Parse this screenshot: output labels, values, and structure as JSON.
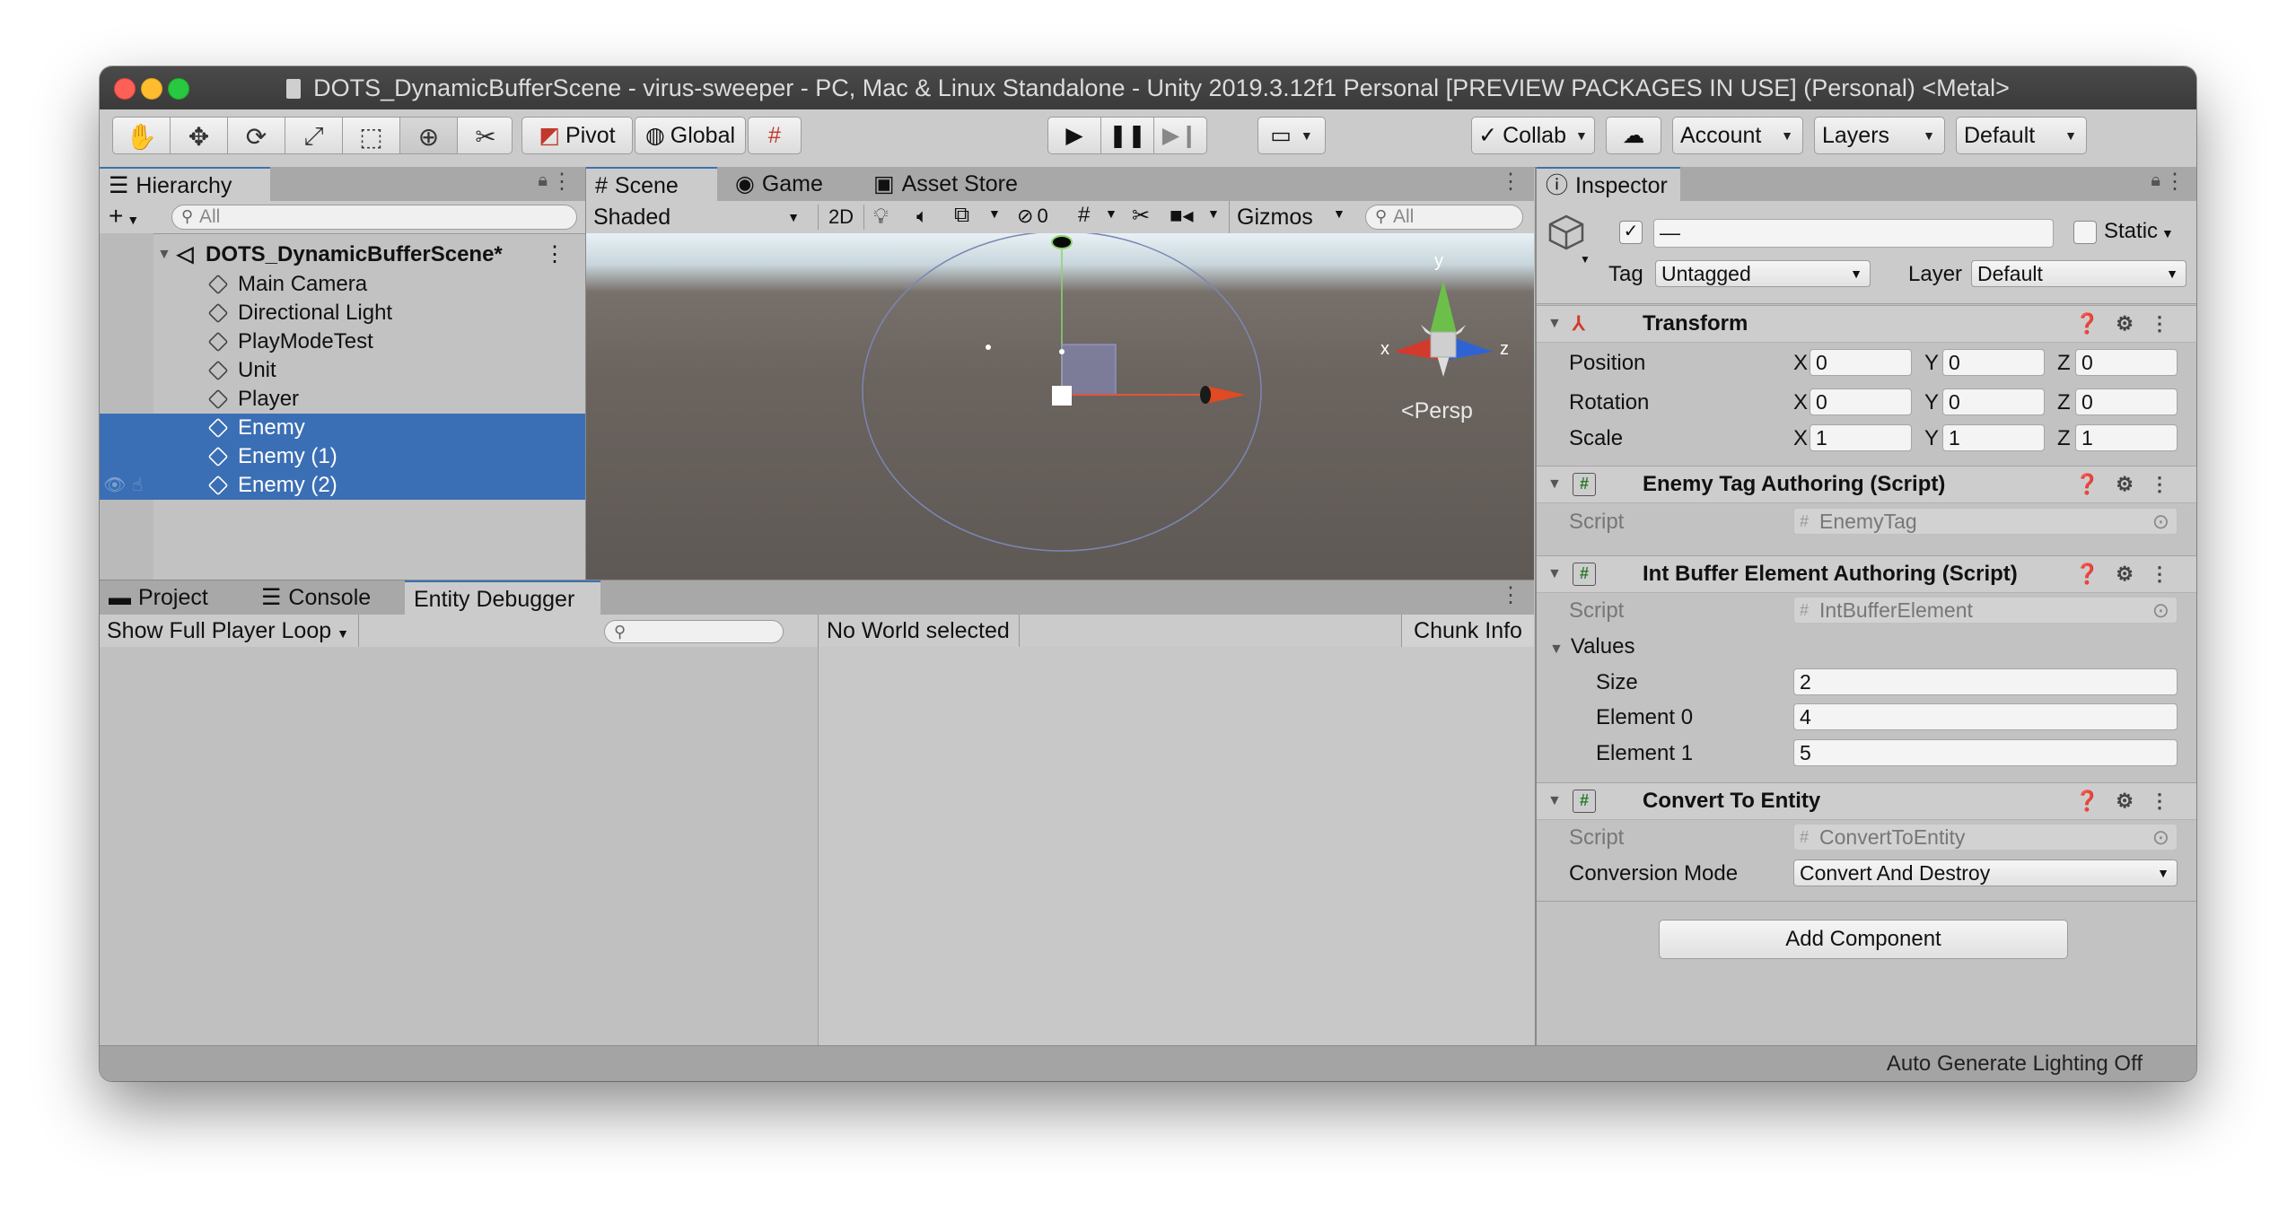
{
  "window": {
    "title": "DOTS_DynamicBufferScene - virus-sweeper - PC, Mac & Linux Standalone - Unity 2019.3.12f1 Personal [PREVIEW PACKAGES IN USE] (Personal) <Metal>"
  },
  "toolbar": {
    "pivot": "Pivot",
    "global": "Global",
    "collab": "Collab",
    "account": "Account",
    "layers": "Layers",
    "layout": "Default"
  },
  "hierarchy": {
    "tab": "Hierarchy",
    "search_placeholder": "All",
    "scene": "DOTS_DynamicBufferScene*",
    "items": [
      {
        "label": "Main Camera"
      },
      {
        "label": "Directional Light"
      },
      {
        "label": "PlayModeTest"
      },
      {
        "label": "Unit"
      },
      {
        "label": "Player"
      },
      {
        "label": "Enemy"
      },
      {
        "label": "Enemy (1)"
      },
      {
        "label": "Enemy (2)"
      }
    ]
  },
  "scene_view": {
    "tabs": [
      "Scene",
      "Game",
      "Asset Store"
    ],
    "shading": "Shaded",
    "mode_2d": "2D",
    "hidden_count": "0",
    "gizmos": "Gizmos",
    "search_placeholder": "All",
    "projection": "Persp",
    "axis_x": "x",
    "axis_y": "y",
    "axis_z": "z"
  },
  "bottom": {
    "tabs": [
      "Project",
      "Console",
      "Entity Debugger"
    ],
    "player_loop": "Show Full Player Loop",
    "world": "No World selected",
    "chunk_info": "Chunk Info"
  },
  "inspector": {
    "tab": "Inspector",
    "name_value": "—",
    "static": "Static",
    "tag_label": "Tag",
    "tag_value": "Untagged",
    "layer_label": "Layer",
    "layer_value": "Default",
    "transform": {
      "title": "Transform",
      "rows": [
        {
          "label": "Position",
          "x": "0",
          "y": "0",
          "z": "0"
        },
        {
          "label": "Rotation",
          "x": "0",
          "y": "0",
          "z": "0"
        },
        {
          "label": "Scale",
          "x": "1",
          "y": "1",
          "z": "1"
        }
      ],
      "x": "X",
      "y": "Y",
      "z": "Z"
    },
    "enemy_tag": {
      "title": "Enemy Tag Authoring (Script)",
      "script_label": "Script",
      "script_value": "EnemyTag"
    },
    "int_buffer": {
      "title": "Int Buffer Element Authoring (Script)",
      "script_label": "Script",
      "script_value": "IntBufferElement",
      "values_label": "Values",
      "size_label": "Size",
      "size_value": "2",
      "element0_label": "Element 0",
      "element0_value": "4",
      "element1_label": "Element 1",
      "element1_value": "5"
    },
    "convert": {
      "title": "Convert To Entity",
      "script_label": "Script",
      "script_value": "ConvertToEntity",
      "mode_label": "Conversion Mode",
      "mode_value": "Convert And Destroy"
    },
    "add_component": "Add Component"
  },
  "status_bar": {
    "text": "Auto Generate Lighting Off"
  }
}
